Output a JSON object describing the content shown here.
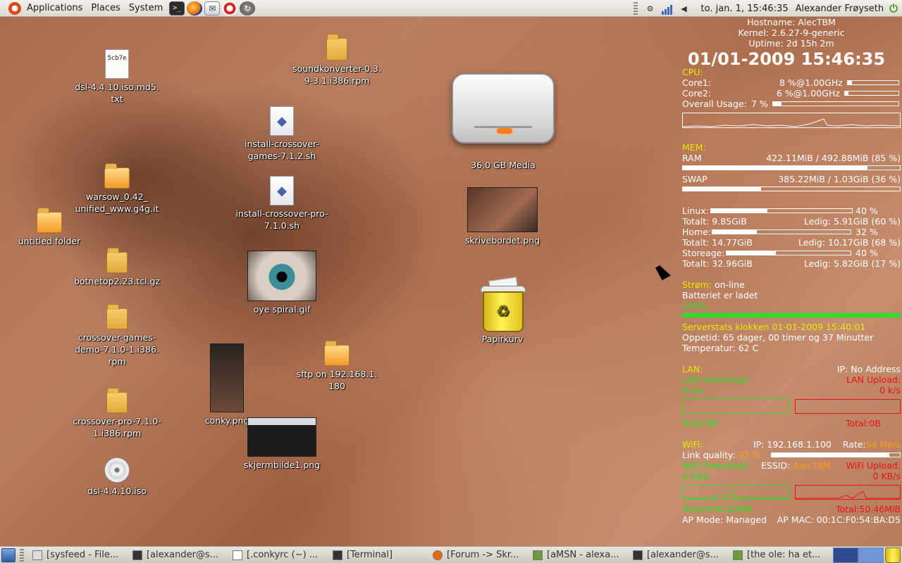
{
  "top_panel": {
    "menus": [
      "Applications",
      "Places",
      "System"
    ],
    "clock": "to. jan.  1, 15:46:35",
    "user": "Alexander Frøyseth",
    "launchers": [
      "terminal-icon",
      "firefox-icon",
      "evolution-mail-icon",
      "help-icon",
      "update-manager-icon"
    ],
    "tray": [
      "network-manager-icon",
      "signal-strength-icon",
      "volume-icon"
    ]
  },
  "desktop_icons": [
    {
      "label": "dsl-4.4.10.iso.md5.\ntxt",
      "type": "text-file",
      "preview": "5cb7e"
    },
    {
      "label": "soundkonverter-0.3.\n9-3.1.i386.rpm",
      "type": "package"
    },
    {
      "label": "install-crossover-\ngames-7.1.2.sh",
      "type": "script"
    },
    {
      "label": "warsow_0.42_\nunified_www.g4g.it",
      "type": "folder"
    },
    {
      "label": "install-crossover-pro-\n7.1.0.sh",
      "type": "script"
    },
    {
      "label": "untitled folder",
      "type": "folder"
    },
    {
      "label": "botnetop2.23.tcl.gz",
      "type": "package"
    },
    {
      "label": "oye spiral.gif",
      "type": "image"
    },
    {
      "label": "crossover-games-\ndemo-7.1.0-1.i386.\nrpm",
      "type": "package"
    },
    {
      "label": "sftp on 192.168.1.\n180",
      "type": "network-folder"
    },
    {
      "label": "conky.png",
      "type": "image"
    },
    {
      "label": "crossover-pro-7.1.0-\n1.i386.rpm",
      "type": "package"
    },
    {
      "label": "skjermbilde1.png",
      "type": "image"
    },
    {
      "label": "dsl-4.4.10.iso",
      "type": "disc-image"
    },
    {
      "label": "36,0 GB Media",
      "type": "drive"
    },
    {
      "label": "skrivebordet.png",
      "type": "image"
    },
    {
      "label": "Papirkurv",
      "type": "trash"
    }
  ],
  "conky": {
    "hostname": "Hostname: AlecTBM",
    "kernel": "Kernel: 2.6.27-9-generic",
    "uptime": "Uptime: 2d 15h 2m",
    "datetime": "01/01-2009 15:46:35",
    "cpu": {
      "header": "CPU:",
      "cores": [
        {
          "label": "Core1:",
          "value": "8  %@1.00GHz",
          "fraction": 0.08
        },
        {
          "label": "Core2:",
          "value": "6  %@1.00GHz",
          "fraction": 0.06
        }
      ],
      "overall_label": "Overall Usage:",
      "overall_value": "7  %",
      "overall_fraction": 0.07
    },
    "mem": {
      "header": "MEM:",
      "ram_label": "RAM",
      "ram_value": "422.11MiB / 492.88MiB (85 %)",
      "ram_fraction": 0.85,
      "swap_label": "SWAP",
      "swap_value": "385.22MiB / 1.03GiB   (36 %)",
      "swap_fraction": 0.36
    },
    "disks": [
      {
        "label": "Linux:",
        "percent": "40 %",
        "fraction": 0.4,
        "total": "Totalt: 9.85GiB",
        "free": "Ledig: 5.91GiB  (60 %)"
      },
      {
        "label": "Home:",
        "percent": "32 %",
        "fraction": 0.32,
        "total": "Totalt: 14.77GiB",
        "free": "Ledig: 10.17GiB (68 %)"
      },
      {
        "label": "Storeage:",
        "percent": "40 %",
        "fraction": 0.4,
        "total": "Totalt: 32.96GiB",
        "free": "Ledig: 5.82GiB   (17 %)"
      }
    ],
    "power": {
      "label": "Strøm:",
      "status": "on-line",
      "battery": "Batteriet er ladet",
      "percent": "100%",
      "fraction": 1.0
    },
    "server": {
      "title": "Serverstats klokken 01-01-2009 15:40:01",
      "uptime": "Oppetid: 65 dager, 00 timer og 37 Minutter",
      "temperature": "Temperatur: 62 C"
    },
    "lan": {
      "header": "LAN:",
      "ip": "IP: No Address",
      "download_label": "LAN Download:",
      "upload_label": "LAN Upload:",
      "download_value": "0    k/s",
      "upload_value": "0    k/s",
      "download_total": "Total:0B",
      "upload_total": "Total:0B"
    },
    "wifi": {
      "header": "WiFi:",
      "ip": "IP: 192.168.1.100",
      "rate_label": "Rate:",
      "rate_value": "54 Mb/s",
      "quality_label": "Link quality:",
      "quality_value": "92",
      "quality_unit": "%",
      "quality_fraction": 0.92,
      "download_label": "WiFi Download:",
      "essid_label": "ESSID:",
      "essid_value": "AlecTBM",
      "upload_label": "WiFi Upload:",
      "download_value": "0    KB/s",
      "upload_value": "0    KB/s",
      "download_total": "Total:476.01MiB",
      "upload_total": "Total:50.46MiB",
      "ap_mode": "AP Mode: Managed",
      "ap_mac": "AP MAC: 00:1C:F0:54:BA:D5"
    }
  },
  "taskbar": {
    "tasks": [
      "[sysfeed - File...",
      "[alexander@s...",
      "[.conkyrc (~) ...",
      "[Terminal]",
      "[Forum -> Skr...",
      "[aMSN - alexa...",
      "[alexander@s...",
      "[the ole: ha et..."
    ]
  },
  "colors": {
    "conky_header": "#e8e800",
    "conky_green": "#27e027",
    "conky_red": "#ee1111",
    "conky_orange": "#ff9c14",
    "panel_bg": "#e9e5df"
  }
}
